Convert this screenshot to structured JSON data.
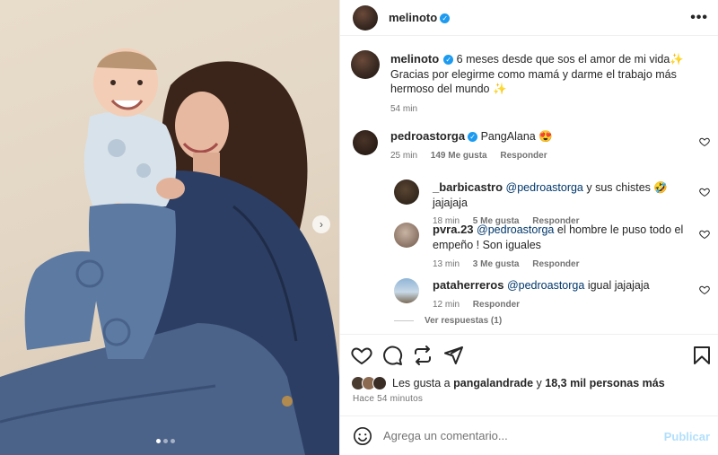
{
  "post": {
    "author": "melinoto",
    "more_icon": "more-horizontal-icon",
    "caption_line1": "6 meses desde que sos el amor de mi vida",
    "caption_line2": "Gracias por elegirme como mamá y darme el trabajo más hermoso del mundo",
    "sparkle": "✨",
    "caption_time": "54 min",
    "photo_description": "Mujer con cabello largo sostiene a un bebé sonriente, ambos con ropa de mezclilla",
    "carousel_next": "›",
    "carousel_position": 1,
    "carousel_count": 3
  },
  "comments": [
    {
      "user": "pedroastorga",
      "verified": true,
      "text": "PangAlana",
      "emoji": "😍",
      "time": "25 min",
      "likes": "149 Me gusta",
      "reply": "Responder"
    },
    {
      "user": "_barbicastro",
      "mention": "@pedroastorga",
      "text": "y sus chistes",
      "emoji": "🤣",
      "text2": "jajajaja",
      "time": "18 min",
      "likes": "5 Me gusta",
      "reply": "Responder"
    },
    {
      "user": "pvra.23",
      "mention": "@pedroastorga",
      "text": "el hombre le puso todo el empeño ! Son iguales",
      "time": "13 min",
      "likes": "3 Me gusta",
      "reply": "Responder"
    },
    {
      "user": "pataherreros",
      "mention": "@pedroastorga",
      "text": "igual jajajaja",
      "time": "12 min",
      "reply": "Responder"
    }
  ],
  "view_replies": "Ver respuestas (1)",
  "actions": {
    "like_icon": "heart-icon",
    "comment_icon": "comment-icon",
    "share_icon": "repost-icon",
    "send_icon": "send-icon",
    "save_icon": "bookmark-icon"
  },
  "likes": {
    "prefix": "Les gusta a",
    "user": "pangalandrade",
    "joiner": "y",
    "others": "18,3 mil personas más"
  },
  "timestamp": "Hace 54 minutos",
  "composer": {
    "emoji_icon": "smiley-icon",
    "placeholder": "Agrega un comentario...",
    "publish": "Publicar"
  },
  "colors": {
    "verified": "#1d9bf0",
    "mention": "#00376b",
    "publish_disabled": "#b2dffc",
    "muted": "#737373"
  }
}
